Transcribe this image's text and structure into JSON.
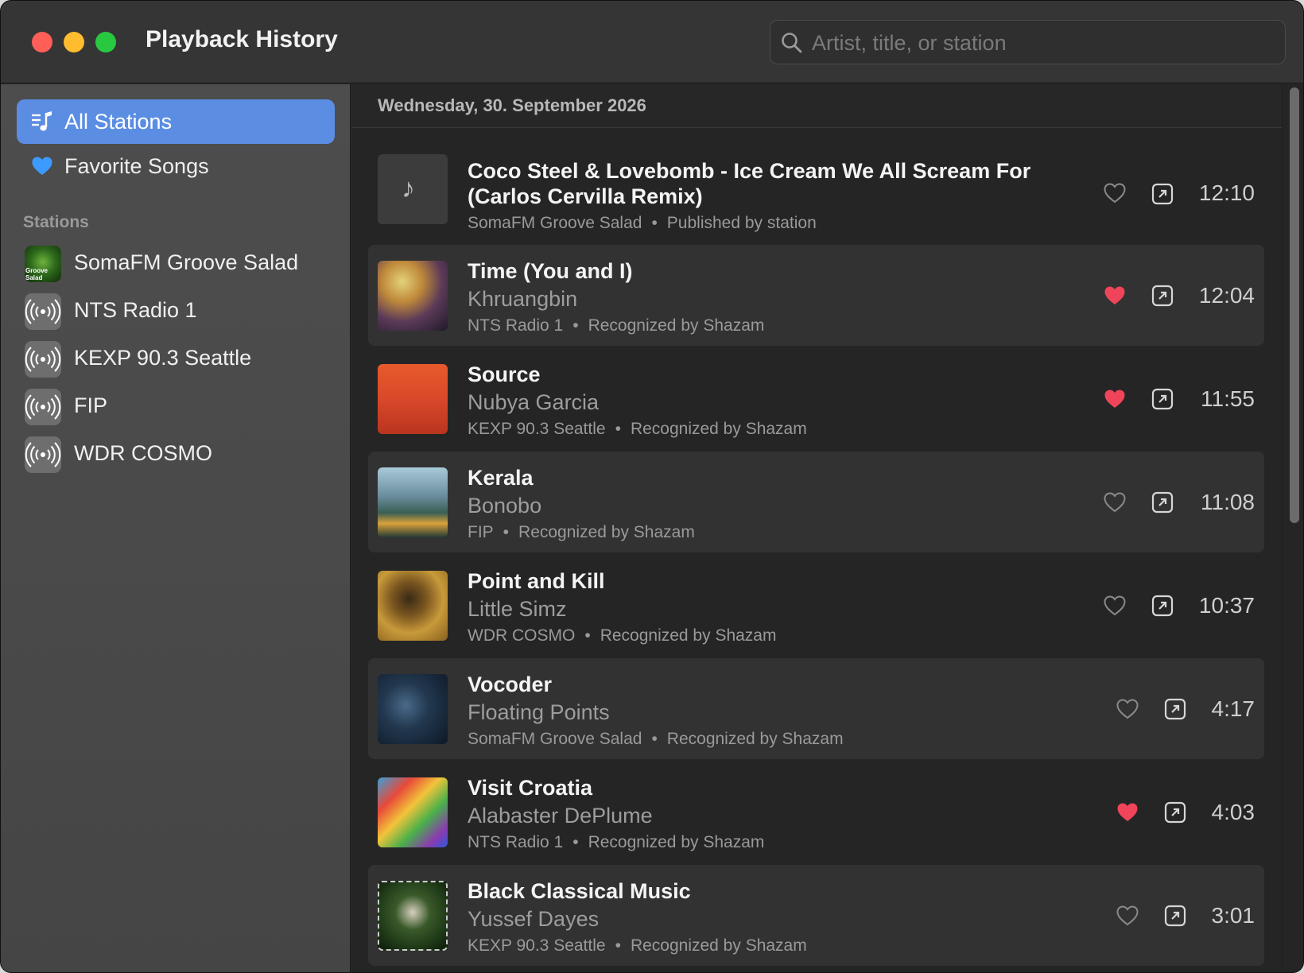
{
  "window": {
    "title": "Playback History"
  },
  "search": {
    "placeholder": "Artist, title, or station"
  },
  "sidebar": {
    "items": [
      {
        "label": "All Stations",
        "icon": "music-list-icon",
        "selected": true
      },
      {
        "label": "Favorite Songs",
        "icon": "heart-icon",
        "selected": false
      }
    ],
    "section_label": "Stations",
    "stations": [
      {
        "name": "SomaFM Groove Salad",
        "icon": "station-artwork",
        "art_text": "Groove Salad"
      },
      {
        "name": "NTS Radio 1",
        "icon": "broadcast-icon"
      },
      {
        "name": "KEXP 90.3 Seattle",
        "icon": "broadcast-icon"
      },
      {
        "name": "FIP",
        "icon": "broadcast-icon"
      },
      {
        "name": "WDR COSMO",
        "icon": "broadcast-icon"
      }
    ]
  },
  "main": {
    "date_header": "Wednesday, 30. September 2026",
    "tracks": [
      {
        "title_line1": "Coco Steel & Lovebomb - Ice Cream We All Scream For",
        "title_line2": "(Carlos Cervilla Remix)",
        "artist": "",
        "station": "SomaFM Groove Salad",
        "source": "Published by station",
        "time": "12:10",
        "favorite": false
      },
      {
        "title_line1": "Time (You and I)",
        "artist": "Khruangbin",
        "station": "NTS Radio 1",
        "source": "Recognized by Shazam",
        "time": "12:04",
        "favorite": true
      },
      {
        "title_line1": "Source",
        "artist": "Nubya Garcia",
        "station": "KEXP 90.3 Seattle",
        "source": "Recognized by Shazam",
        "time": "11:55",
        "favorite": true
      },
      {
        "title_line1": "Kerala",
        "artist": "Bonobo",
        "station": "FIP",
        "source": "Recognized by Shazam",
        "time": "11:08",
        "favorite": false
      },
      {
        "title_line1": "Point and Kill",
        "artist": "Little Simz",
        "station": "WDR COSMO",
        "source": "Recognized by Shazam",
        "time": "10:37",
        "favorite": false
      },
      {
        "title_line1": "Vocoder",
        "artist": "Floating Points",
        "station": "SomaFM Groove Salad",
        "source": "Recognized by Shazam",
        "time": "4:17",
        "favorite": false
      },
      {
        "title_line1": "Visit Croatia",
        "artist": "Alabaster DePlume",
        "station": "NTS Radio 1",
        "source": "Recognized by Shazam",
        "time": "4:03",
        "favorite": true
      },
      {
        "title_line1": "Black Classical Music",
        "artist": "Yussef Dayes",
        "station": "KEXP 90.3 Seattle",
        "source": "Recognized by Shazam",
        "time": "3:01",
        "favorite": false
      }
    ]
  },
  "colors": {
    "selection": "#5b8de3",
    "favorite_heart": "#f0445a",
    "sidebar_heart": "#3d9bff"
  }
}
